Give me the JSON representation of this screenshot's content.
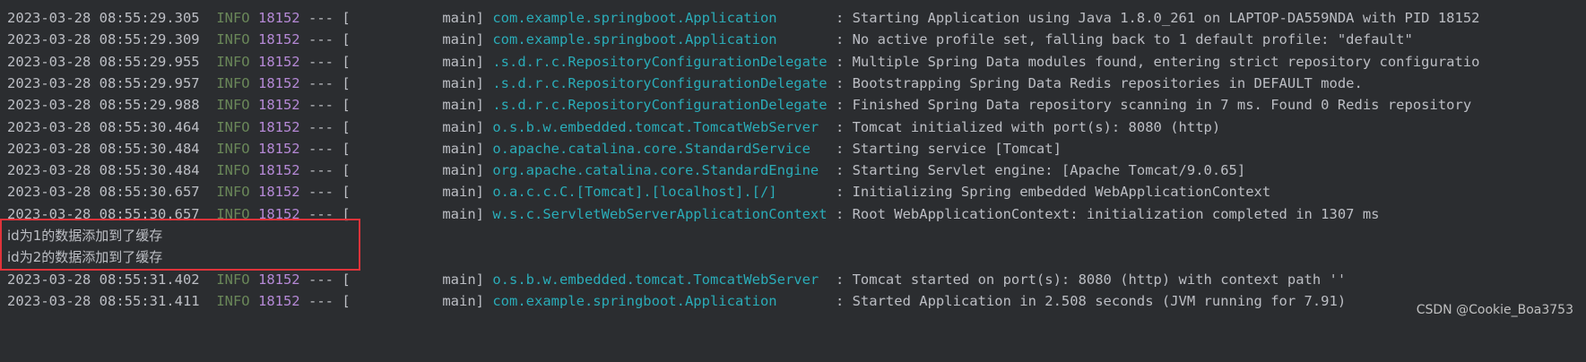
{
  "lines": [
    {
      "ts": "2023-03-28 08:55:29.305",
      "level": "INFO",
      "pid": "18152",
      "sep": "---",
      "thread": "[           main]",
      "logger": "com.example.springboot.Application       ",
      "msg": ": Starting Application using Java 1.8.0_261 on LAPTOP-DA559NDA with PID 18152"
    },
    {
      "ts": "2023-03-28 08:55:29.309",
      "level": "INFO",
      "pid": "18152",
      "sep": "---",
      "thread": "[           main]",
      "logger": "com.example.springboot.Application       ",
      "msg": ": No active profile set, falling back to 1 default profile: \"default\""
    },
    {
      "ts": "2023-03-28 08:55:29.955",
      "level": "INFO",
      "pid": "18152",
      "sep": "---",
      "thread": "[           main]",
      "logger": ".s.d.r.c.RepositoryConfigurationDelegate",
      "msg": " : Multiple Spring Data modules found, entering strict repository configuratio"
    },
    {
      "ts": "2023-03-28 08:55:29.957",
      "level": "INFO",
      "pid": "18152",
      "sep": "---",
      "thread": "[           main]",
      "logger": ".s.d.r.c.RepositoryConfigurationDelegate",
      "msg": " : Bootstrapping Spring Data Redis repositories in DEFAULT mode."
    },
    {
      "ts": "2023-03-28 08:55:29.988",
      "level": "INFO",
      "pid": "18152",
      "sep": "---",
      "thread": "[           main]",
      "logger": ".s.d.r.c.RepositoryConfigurationDelegate",
      "msg": " : Finished Spring Data repository scanning in 7 ms. Found 0 Redis repository"
    },
    {
      "ts": "2023-03-28 08:55:30.464",
      "level": "INFO",
      "pid": "18152",
      "sep": "---",
      "thread": "[           main]",
      "logger": "o.s.b.w.embedded.tomcat.TomcatWebServer ",
      "msg": " : Tomcat initialized with port(s): 8080 (http)"
    },
    {
      "ts": "2023-03-28 08:55:30.484",
      "level": "INFO",
      "pid": "18152",
      "sep": "---",
      "thread": "[           main]",
      "logger": "o.apache.catalina.core.StandardService  ",
      "msg": " : Starting service [Tomcat]"
    },
    {
      "ts": "2023-03-28 08:55:30.484",
      "level": "INFO",
      "pid": "18152",
      "sep": "---",
      "thread": "[           main]",
      "logger": "org.apache.catalina.core.StandardEngine ",
      "msg": " : Starting Servlet engine: [Apache Tomcat/9.0.65]"
    },
    {
      "ts": "2023-03-28 08:55:30.657",
      "level": "INFO",
      "pid": "18152",
      "sep": "---",
      "thread": "[           main]",
      "logger": "o.a.c.c.C.[Tomcat].[localhost].[/]      ",
      "msg": " : Initializing Spring embedded WebApplicationContext"
    },
    {
      "ts": "2023-03-28 08:55:30.657",
      "level": "INFO",
      "pid": "18152",
      "sep": "---",
      "thread": "[           main]",
      "logger": "w.s.c.ServletWebServerApplicationContext",
      "msg": " : Root WebApplicationContext: initialization completed in 1307 ms"
    }
  ],
  "plain_lines": [
    "id为1的数据添加到了缓存",
    "id为2的数据添加到了缓存"
  ],
  "tail_lines": [
    {
      "ts": "2023-03-28 08:55:31.402",
      "level": "INFO",
      "pid": "18152",
      "sep": "---",
      "thread": "[           main]",
      "logger": "o.s.b.w.embedded.tomcat.TomcatWebServer ",
      "msg": " : Tomcat started on port(s): 8080 (http) with context path ''"
    },
    {
      "ts": "2023-03-28 08:55:31.411",
      "level": "INFO",
      "pid": "18152",
      "sep": "---",
      "thread": "[           main]",
      "logger": "com.example.springboot.Application       ",
      "msg": ": Started Application in 2.508 seconds (JVM running for 7.91)"
    }
  ],
  "watermark": "CSDN @Cookie_Boa3753",
  "colors": {
    "background": "#2b2d30",
    "text": "#bcbec4",
    "level": "#6a8759",
    "pid": "#b589d6",
    "logger": "#2aacb8",
    "highlight_border": "#e0333a"
  }
}
